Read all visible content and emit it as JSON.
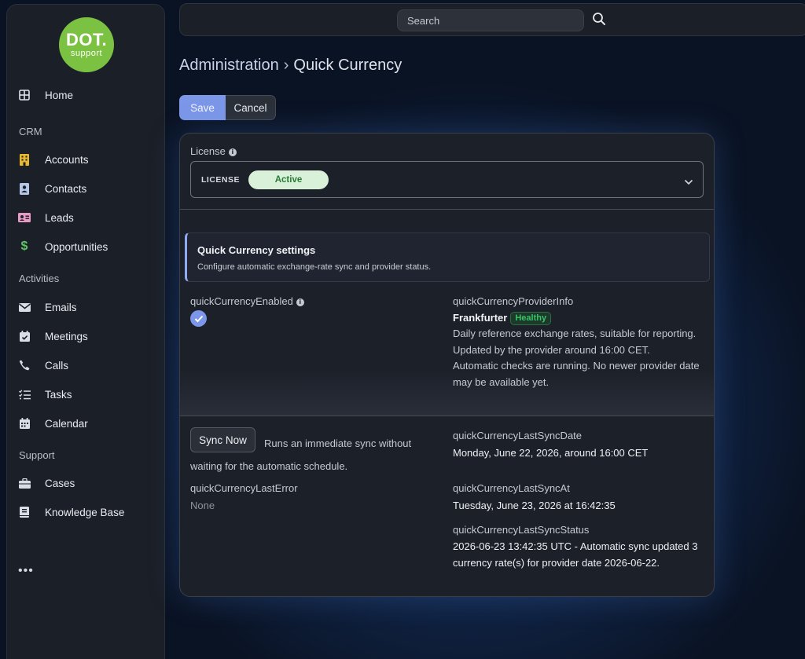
{
  "logo": {
    "line1": "DOT.",
    "line2": "support"
  },
  "sidebar": {
    "home": "Home",
    "groups": {
      "crm": "CRM",
      "activities": "Activities",
      "support": "Support"
    },
    "items": {
      "accounts": "Accounts",
      "contacts": "Contacts",
      "leads": "Leads",
      "opportunities": "Opportunities",
      "emails": "Emails",
      "meetings": "Meetings",
      "calls": "Calls",
      "tasks": "Tasks",
      "calendar": "Calendar",
      "cases": "Cases",
      "knowledge_base": "Knowledge Base"
    },
    "more": "•••"
  },
  "topbar": {
    "search_placeholder": "Search"
  },
  "breadcrumb": {
    "parent": "Administration",
    "separator": "›",
    "current": "Quick Currency"
  },
  "toolbar": {
    "save_label": "Save",
    "cancel_label": "Cancel"
  },
  "license": {
    "field_label": "License",
    "key": "LICENSE",
    "status": "Active"
  },
  "settings": {
    "title": "Quick Currency settings",
    "subtitle": "Configure automatic exchange-rate sync and provider status."
  },
  "fields": {
    "enabled_label": "quickCurrencyEnabled",
    "enabled_value": true,
    "provider_label": "quickCurrencyProviderInfo",
    "provider_name": "Frankfurter",
    "provider_health": "Healthy",
    "provider_desc": "Daily reference exchange rates, suitable for reporting.",
    "provider_updated": "Updated by the provider around 16:00 CET.",
    "provider_checks": "Automatic checks are running. No newer provider date may be available yet.",
    "sync_button": "Sync Now",
    "sync_desc": "Runs an immediate sync without waiting for the automatic schedule.",
    "last_sync_date_label": "quickCurrencyLastSyncDate",
    "last_sync_date_value": "Monday, June 22, 2026, around 16:00 CET",
    "last_error_label": "quickCurrencyLastError",
    "last_error_value": "None",
    "last_sync_at_label": "quickCurrencyLastSyncAt",
    "last_sync_at_value": "Tuesday, June 23, 2026 at 16:42:35",
    "last_sync_status_label": "quickCurrencyLastSyncStatus",
    "last_sync_status_value": "2026-06-23 13:42:35 UTC - Automatic sync updated 3 currency rate(s) for provider date 2026-06-22."
  },
  "colors": {
    "accent": "#7c97e8",
    "logo_green": "#7cc242",
    "active_pill": "#d8f1d8",
    "healthy": "#38c46a"
  }
}
